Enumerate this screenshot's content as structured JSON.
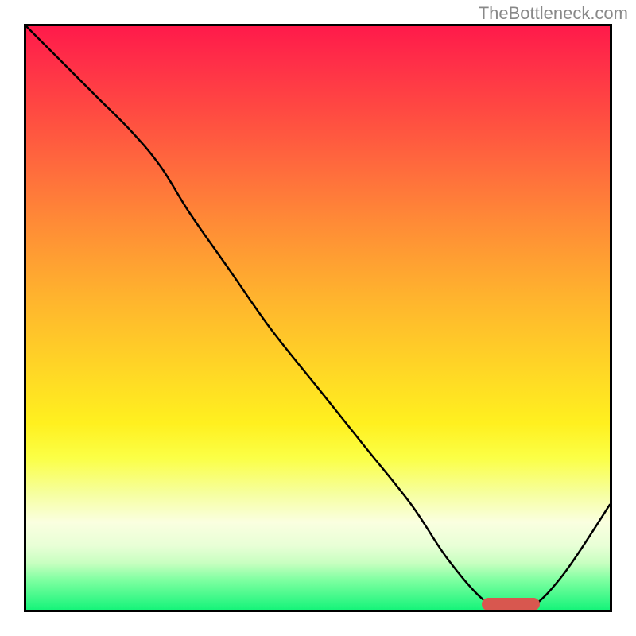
{
  "attribution": "TheBottleneck.com",
  "colors": {
    "curve_stroke": "#000000",
    "marker_fill": "#d8574f",
    "border": "#000000",
    "attribution_text": "#888888"
  },
  "chart_data": {
    "type": "line",
    "title": "",
    "xlabel": "",
    "ylabel": "",
    "xlim": [
      0,
      100
    ],
    "ylim": [
      0,
      100
    ],
    "x": [
      0,
      6,
      12,
      18,
      23,
      28,
      35,
      42,
      50,
      58,
      66,
      72,
      78,
      82,
      86,
      92,
      100
    ],
    "y": [
      100,
      94,
      88,
      82,
      76,
      68,
      58,
      48,
      38,
      28,
      18,
      9,
      2,
      0,
      0,
      6,
      18
    ],
    "marker": {
      "x_start": 78,
      "x_end": 88,
      "y": 1
    },
    "annotations": []
  }
}
